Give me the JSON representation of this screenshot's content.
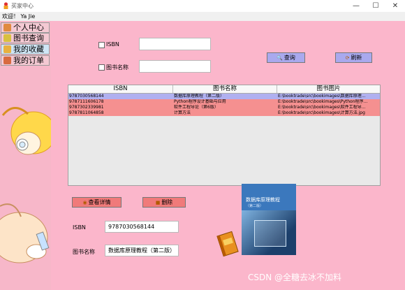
{
  "window": {
    "title": "买家中心",
    "welcome": "欢迎！ Ya Jie",
    "controls": {
      "minimize": "—",
      "maximize": "☐",
      "close": "✕"
    }
  },
  "sidebar": {
    "items": [
      {
        "label": "个人中心",
        "icon": "person-icon",
        "active": false
      },
      {
        "label": "图书查询",
        "icon": "book-search-icon",
        "active": false
      },
      {
        "label": "我的收藏",
        "icon": "favorites-icon",
        "active": true
      },
      {
        "label": "我的订单",
        "icon": "order-icon",
        "active": false
      }
    ]
  },
  "search": {
    "isbn_label": "ISBN",
    "isbn_value": "",
    "title_label": "图书名称",
    "title_value": "",
    "query_button": "查询",
    "refresh_button": "刷新"
  },
  "table": {
    "columns": [
      "ISBN",
      "图书名称",
      "图书图片"
    ],
    "rows": [
      {
        "isbn": "9787030568144",
        "name": "数据库原理教程（第二版）",
        "image": "E:\\booktrade\\src\\bookimages\\数据库原理...",
        "selected": true
      },
      {
        "isbn": "9787111606178",
        "name": "Python程序设计基础与应用",
        "image": "E:\\booktrade\\src\\bookimages\\Python程序...",
        "selected": false
      },
      {
        "isbn": "9787302339981",
        "name": "软件工程导论（第6版）",
        "image": "E:\\booktrade\\src\\bookimages\\软件工程导...",
        "selected": false
      },
      {
        "isbn": "9787811064858",
        "name": "计算方法",
        "image": "E:\\booktrade\\src\\bookimages\\计算方法.jpg",
        "selected": false
      }
    ]
  },
  "actions": {
    "detail_button": "查看详情",
    "delete_button": "删除"
  },
  "detail": {
    "isbn_label": "ISBN",
    "isbn_value": "9787030568144",
    "title_label": "图书名称",
    "title_value": "数据库原理教程（第二版）",
    "cover_title": "数据库原理教程",
    "cover_subtitle": "（第二版）"
  },
  "colors": {
    "main_bg": "#fbb6cb",
    "selected_row": "#b0b0f0",
    "normal_row": "#f59090",
    "blue_button": "#a9a9ee",
    "red_button": "#f07a7a",
    "nav_active": "#cfe6f6"
  },
  "watermark": "CSDN @全糖去冰不加料"
}
